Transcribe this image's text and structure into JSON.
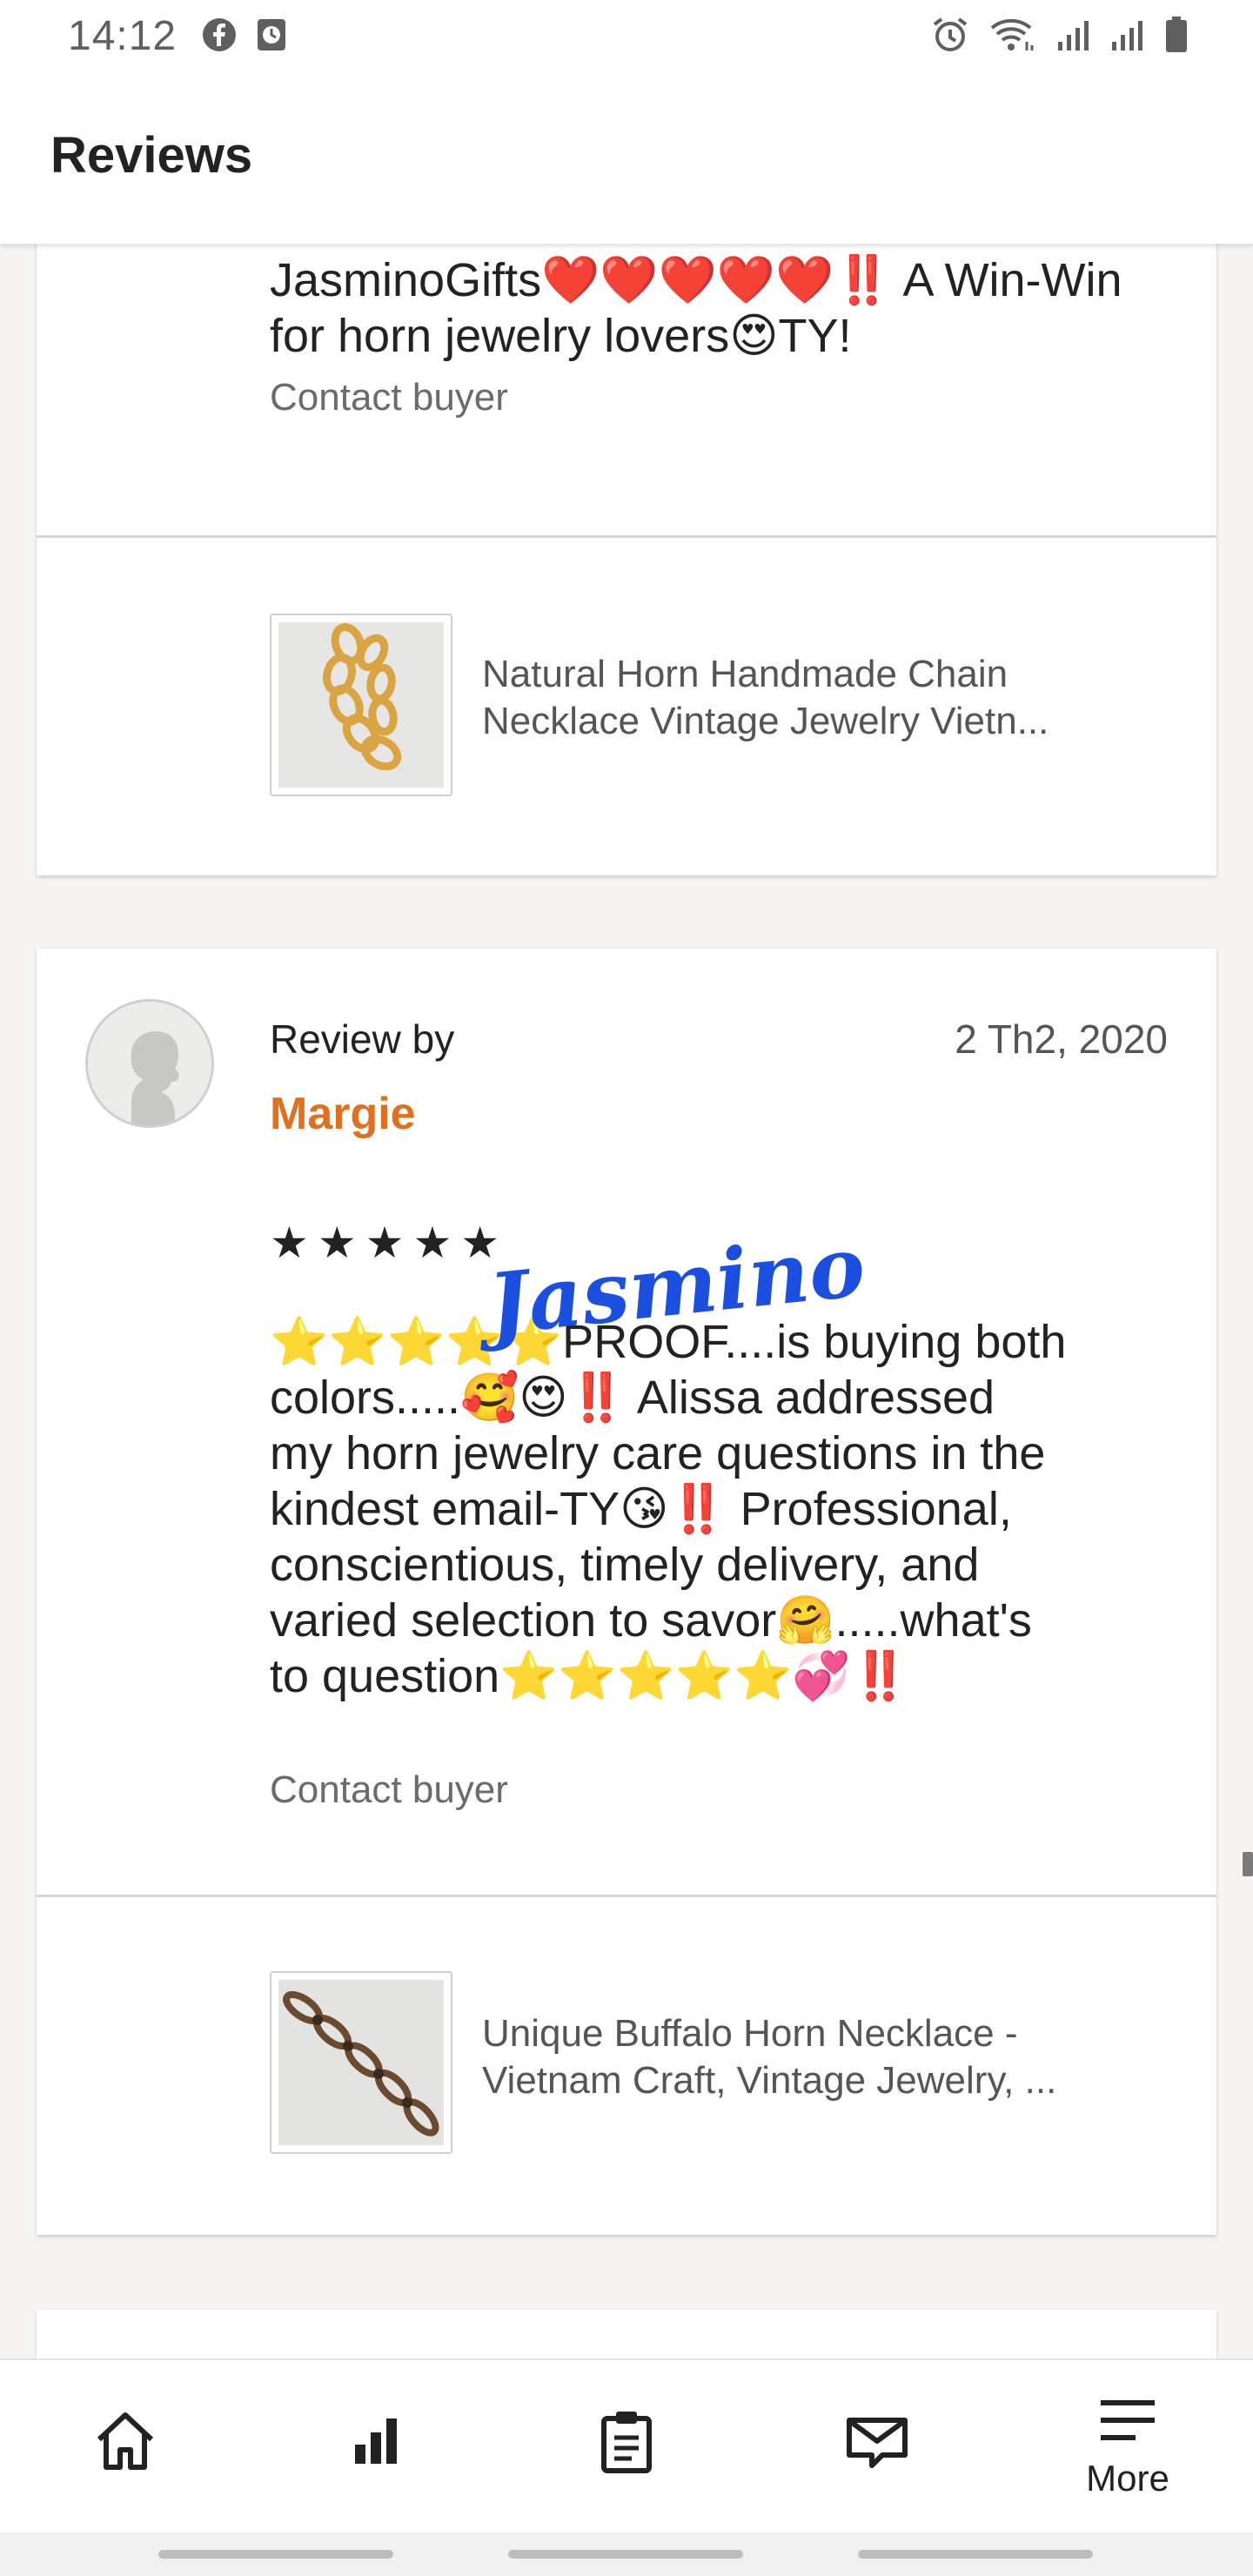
{
  "status_bar": {
    "time": "14:12",
    "left_icons": [
      "facebook-icon",
      "calendar-icon"
    ],
    "right_icons": [
      "alarm-icon",
      "wifi-icon",
      "signal-icon",
      "signal-icon",
      "battery-icon"
    ]
  },
  "header": {
    "title": "Reviews"
  },
  "review_1": {
    "text_line_1": "JasminoGifts❤️❤️❤️❤️❤️‼️ A Win-Win",
    "text_line_2": "for horn jewelry lovers😍TY!",
    "contact_label": "Contact buyer",
    "listing_line_1": "Natural Horn Handmade Chain",
    "listing_line_2": "Necklace Vintage Jewelry Vietn..."
  },
  "review_2": {
    "review_by_label": "Review by",
    "reviewer": "Margie",
    "date": "2 Th2, 2020",
    "stars": "★★★★★",
    "watermark": "Jasmino",
    "text_lines": [
      "⭐⭐⭐⭐⭐PROOF....is buying both",
      "colors.....🥰😍‼️ Alissa addressed",
      "my horn jewelry care questions in the",
      "kindest email-TY😘‼️ Professional,",
      "conscientious, timely delivery, and",
      "varied selection to savor🤗.....what's",
      "to question⭐⭐⭐⭐⭐💞‼️"
    ],
    "contact_label": "Contact buyer",
    "listing_line_1": "Unique Buffalo Horn Necklace -",
    "listing_line_2": "Vietnam Craft, Vintage Jewelry, ..."
  },
  "bottom_nav": {
    "items": [
      {
        "icon": "home-icon",
        "label": ""
      },
      {
        "icon": "stats-icon",
        "label": ""
      },
      {
        "icon": "orders-icon",
        "label": ""
      },
      {
        "icon": "messages-icon",
        "label": ""
      },
      {
        "icon": "menu-icon",
        "label": "More"
      }
    ]
  },
  "colors": {
    "accent": "#e07020",
    "watermark": "#1a4fe0",
    "background": "#f5f4f2"
  }
}
